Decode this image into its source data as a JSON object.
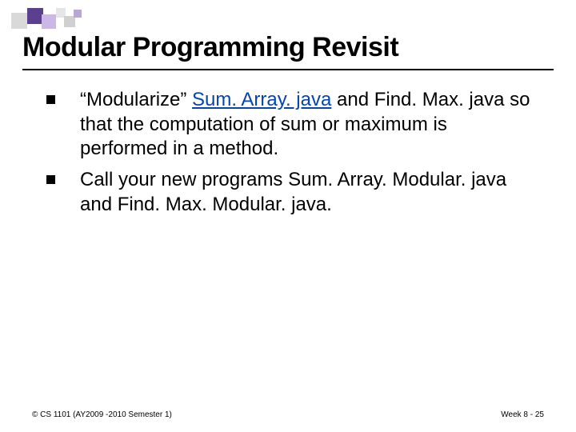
{
  "title": "Modular Programming Revisit",
  "bullets": [
    {
      "prefix": "“Modularize” ",
      "link": "Sum. Array. java",
      "suffix": " and Find. Max. java so that the computation of sum or maximum is performed in a method."
    },
    {
      "prefix": "Call your new programs Sum. Array. Modular. java and Find. Max. Modular. java.",
      "link": "",
      "suffix": ""
    }
  ],
  "footer": {
    "left": "© CS 1101 (AY2009 -2010 Semester 1)",
    "right": "Week 8 - 25"
  }
}
